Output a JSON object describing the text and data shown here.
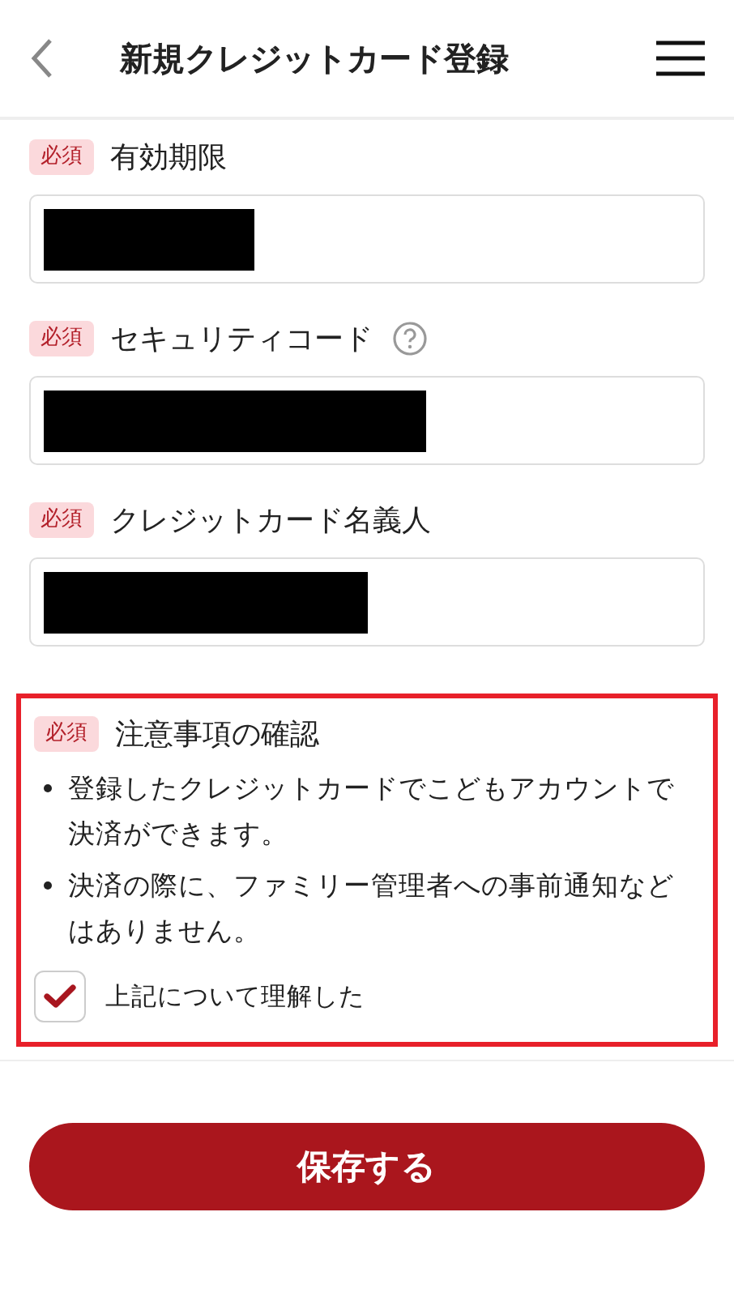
{
  "header": {
    "title": "新規クレジットカード登録"
  },
  "fields": [
    {
      "badge": "必須",
      "label": "有効期限",
      "help": false,
      "redacted": true
    },
    {
      "badge": "必須",
      "label": "セキュリティコード",
      "help": true,
      "redacted": true
    },
    {
      "badge": "必須",
      "label": "クレジットカード名義人",
      "help": false,
      "redacted": true
    }
  ],
  "notice": {
    "badge": "必須",
    "title": "注意事項の確認",
    "highlighted": true,
    "items": [
      "登録したクレジットカードでこどもアカウントで決済ができます。",
      "決済の際に、ファミリー管理者への事前通知などはありません。"
    ],
    "checkbox": {
      "label": "上記について理解した",
      "checked": true
    }
  },
  "save_button": "保存する"
}
